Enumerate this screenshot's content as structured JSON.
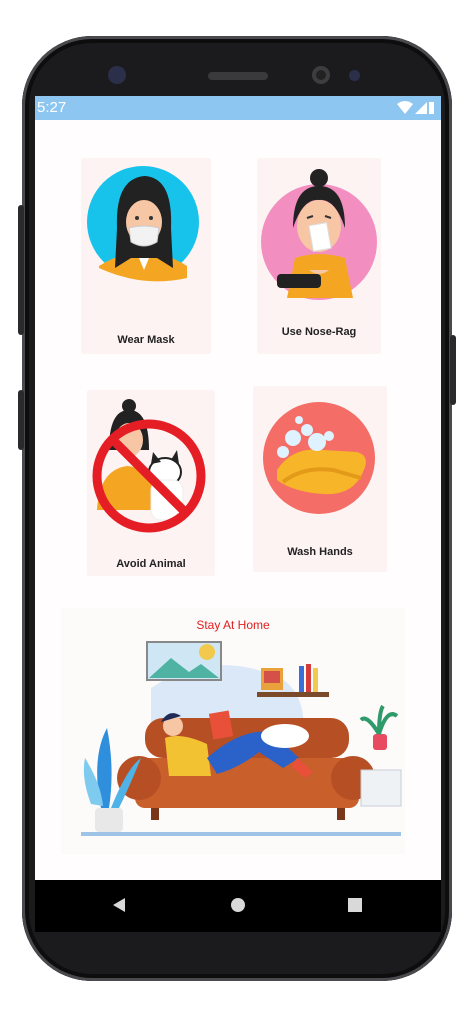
{
  "status_bar": {
    "time": "5:27"
  },
  "tiles": [
    {
      "label": "Wear Mask",
      "icon": "wear-mask-illustration"
    },
    {
      "label": "Use Nose-Rag",
      "icon": "nose-rag-illustration"
    },
    {
      "label": "Avoid Animal",
      "icon": "avoid-animal-illustration"
    },
    {
      "label": "Wash Hands",
      "icon": "wash-hands-illustration"
    }
  ],
  "banner": {
    "title": "Stay At Home",
    "icon": "stay-at-home-illustration"
  },
  "nav": {
    "back": "back-icon",
    "home": "home-icon",
    "recents": "recents-icon"
  },
  "colors": {
    "status_bar": "#8ec6f2",
    "banner_title": "#e02020",
    "bezel": "#1b1b1d"
  }
}
